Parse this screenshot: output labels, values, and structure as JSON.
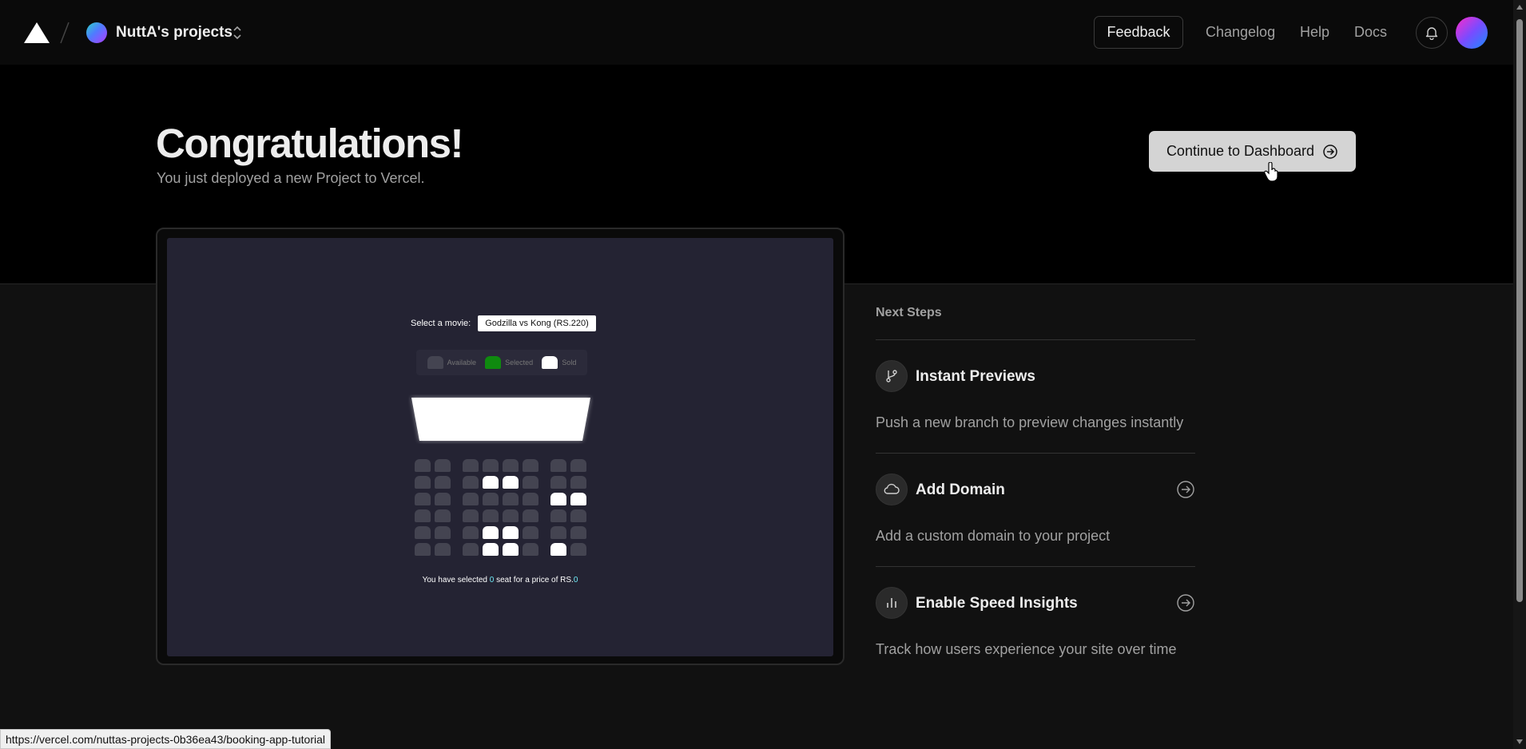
{
  "nav": {
    "project_name": "NuttA's projects",
    "feedback_label": "Feedback",
    "links": [
      "Changelog",
      "Help",
      "Docs"
    ]
  },
  "hero": {
    "title": "Congratulations!",
    "subtitle": "You just deployed a new Project to Vercel.",
    "continue_label": "Continue to Dashboard"
  },
  "preview": {
    "movie_label": "Select a movie:",
    "movie_value": "Godzilla vs Kong (RS.220)",
    "legend": [
      {
        "label": "Available",
        "color": "#444451"
      },
      {
        "label": "Selected",
        "color": "#0f8a0f"
      },
      {
        "label": "Sold",
        "color": "#ffffff"
      }
    ],
    "summary_prefix": "You have selected",
    "seat_count": "0",
    "summary_middle": "seat for a price of RS.",
    "price": "0",
    "seat_rows": [
      "AA.AAAA.AA",
      "AA.ASSA.AA",
      "AA.AAAA.SS",
      "AA.AAAA.AA",
      "AA.ASSA.AA",
      "AA.ASSA.SA"
    ]
  },
  "next_steps": {
    "title": "Next Steps",
    "items": [
      {
        "title": "Instant Previews",
        "desc": "Push a new branch to preview changes instantly",
        "icon": "git-branch-icon"
      },
      {
        "title": "Add Domain",
        "desc": "Add a custom domain to your project",
        "icon": "cloud-icon"
      },
      {
        "title": "Enable Speed Insights",
        "desc": "Track how users experience your site over time",
        "icon": "bar-chart-icon"
      }
    ]
  },
  "status_url": "https://vercel.com/nuttas-projects-0b36ea43/booking-app-tutorial"
}
